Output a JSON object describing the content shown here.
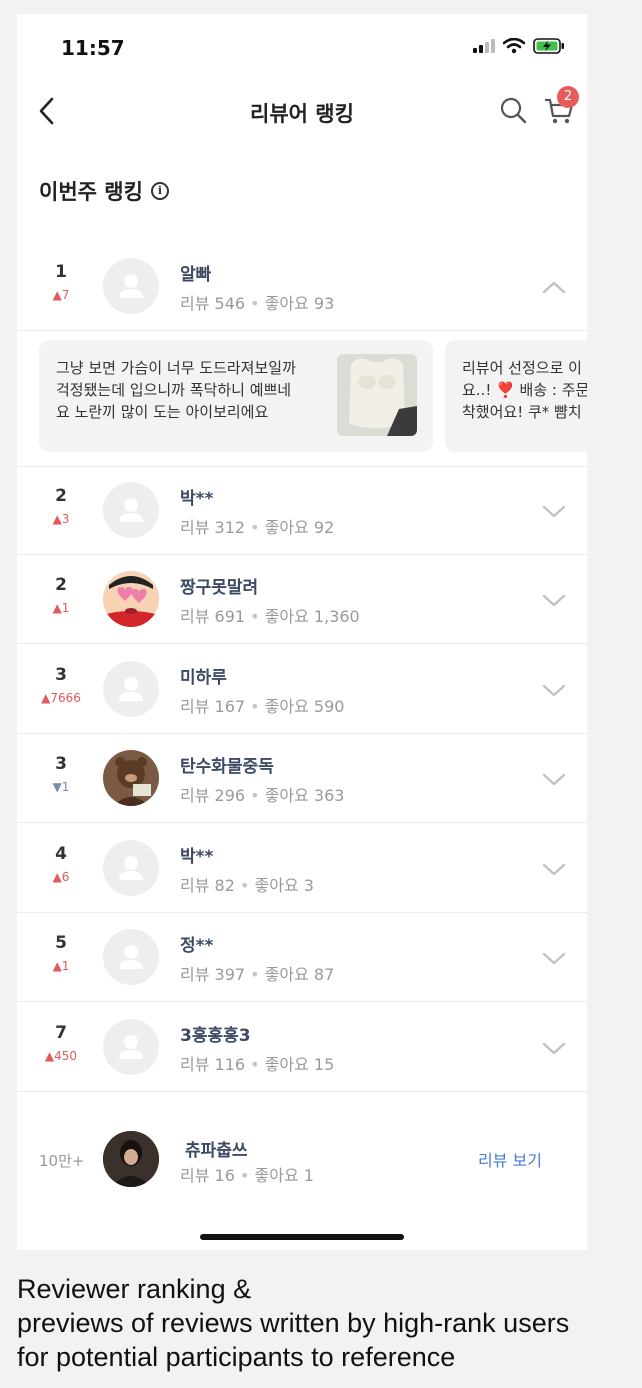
{
  "status_bar": {
    "time": "11:57"
  },
  "header": {
    "title": "리뷰어 랭킹",
    "cart_count": "2"
  },
  "section": {
    "title": "이번주 랭킹",
    "info_glyph": "i"
  },
  "rows": [
    {
      "rank": "1",
      "change": "▲7",
      "direction": "up",
      "name": "알빠",
      "reviews": "리뷰 546",
      "likes": "좋아요 93",
      "expanded": true
    },
    {
      "rank": "2",
      "change": "▲3",
      "direction": "up",
      "name": "박**",
      "reviews": "리뷰 312",
      "likes": "좋아요 92"
    },
    {
      "rank": "2",
      "change": "▲1",
      "direction": "up",
      "name": "짱구못말려",
      "reviews": "리뷰 691",
      "likes": "좋아요 1,360",
      "avatar": "cartoon"
    },
    {
      "rank": "3",
      "change": "▲7666",
      "direction": "up",
      "name": "미하루",
      "reviews": "리뷰 167",
      "likes": "좋아요 590"
    },
    {
      "rank": "3",
      "change": "▼1",
      "direction": "down",
      "name": "탄수화물중독",
      "reviews": "리뷰 296",
      "likes": "좋아요 363",
      "avatar": "bear"
    },
    {
      "rank": "4",
      "change": "▲6",
      "direction": "up",
      "name": "박**",
      "reviews": "리뷰 82",
      "likes": "좋아요 3"
    },
    {
      "rank": "5",
      "change": "▲1",
      "direction": "up",
      "name": "정**",
      "reviews": "리뷰 397",
      "likes": "좋아요 87"
    },
    {
      "rank": "7",
      "change": "▲450",
      "direction": "up",
      "name": "3홍홍홍3",
      "reviews": "리뷰 116",
      "likes": "좋아요 15"
    }
  ],
  "review_cards": [
    {
      "lines": [
        "그냥 보면 가슴이 너무 도드라져보일까",
        "걱정됐는데 입으니까 폭닥하니 예쁘네",
        "요 노란끼 많이 도는 아이보리에요"
      ]
    },
    {
      "lines": [
        "리뷰어 선정으로 이",
        "요..! ❣️ 배송 : 주문",
        "착했어요! 쿠* 뺨치"
      ]
    }
  ],
  "my_rank": {
    "rank": "10만+",
    "name": "츄파춥쓰",
    "reviews": "리뷰 16",
    "likes": "좋아요 1",
    "link": "리뷰 보기"
  },
  "caption": [
    "Reviewer ranking &",
    "previews of reviews written by high-rank users",
    "for potential participants to reference"
  ]
}
